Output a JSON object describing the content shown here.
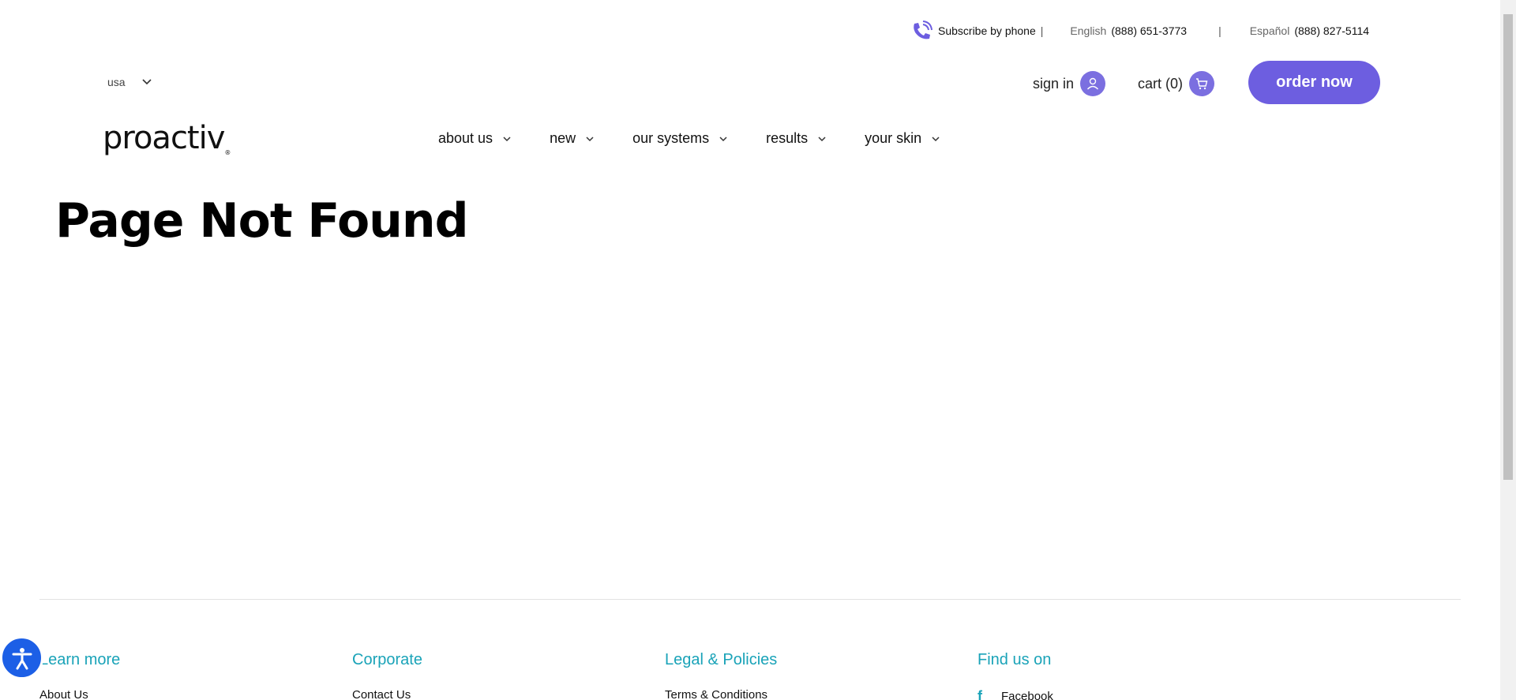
{
  "utility": {
    "subscribe_label": "Subscribe by phone",
    "pipe": "|",
    "english_label": "English",
    "english_number": "(888) 651-3773",
    "espanol_label": "Español",
    "espanol_number": "(888) 827-5114",
    "icon": "phone-icon"
  },
  "locale": {
    "value": "usa"
  },
  "account": {
    "signin_label": "sign in",
    "cart_label": "cart (0)"
  },
  "order_button": "order now",
  "logo": "proactiv",
  "logo_mark": "®",
  "nav": [
    {
      "label": "about us"
    },
    {
      "label": "new"
    },
    {
      "label": "our systems"
    },
    {
      "label": "results"
    },
    {
      "label": "your skin"
    }
  ],
  "page_title": "Page Not Found",
  "footer": {
    "col1": {
      "head": "Learn more",
      "link": "About Us"
    },
    "col2": {
      "head": "Corporate",
      "link": "Contact Us"
    },
    "col3": {
      "head": "Legal & Policies",
      "link": "Terms & Conditions"
    },
    "col4": {
      "head": "Find us on",
      "link": "Facebook"
    }
  },
  "colors": {
    "accent": "#6d5ee0",
    "footer_heading": "#1aa3b8",
    "a11y": "#1c5fe6"
  }
}
